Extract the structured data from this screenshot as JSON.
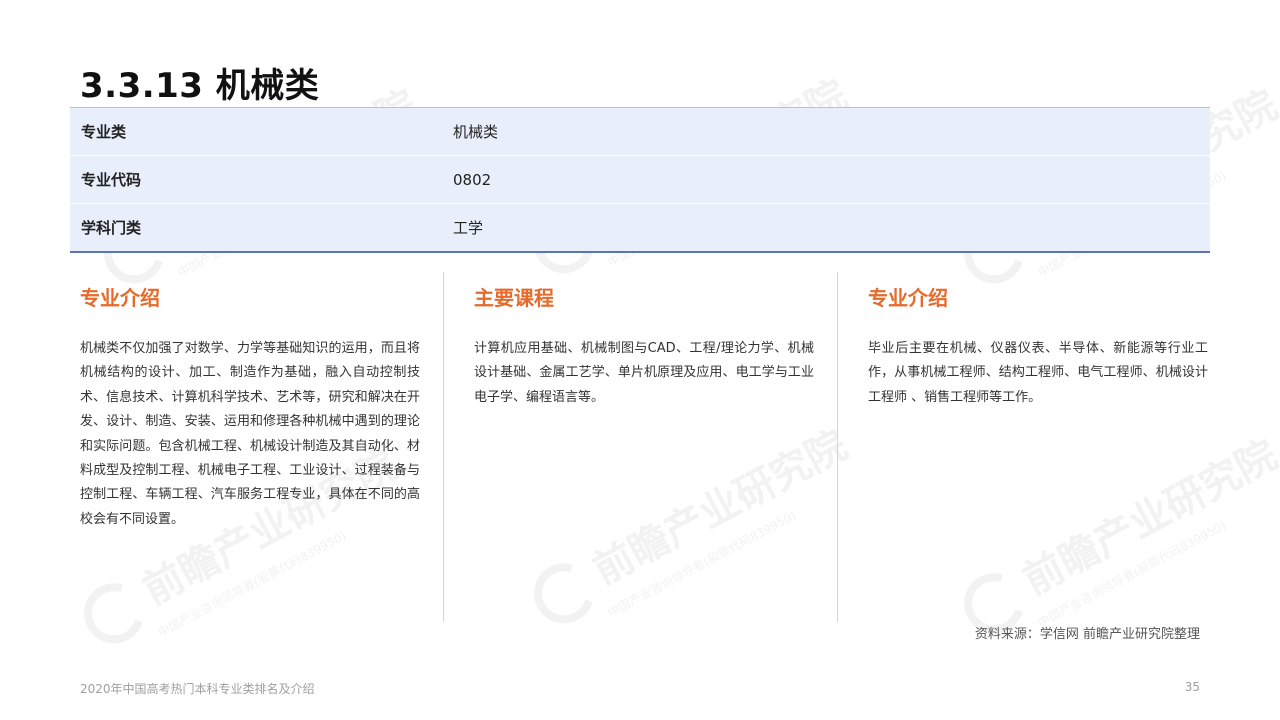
{
  "page": {
    "title": "3.3.13 机械类",
    "footer_left": "2020年中国高考热门本科专业类排名及介绍",
    "page_number": "35",
    "source": "资料来源：学信网 前瞻产业研究院整理"
  },
  "watermark": {
    "brand": "前瞻产业研究院",
    "subtitle": "中国产业咨询领导者(股票代码839950)"
  },
  "info": {
    "rows": [
      {
        "label": "专业类",
        "value": "机械类"
      },
      {
        "label": "专业代码",
        "value": "0802"
      },
      {
        "label": "学科门类",
        "value": "工学"
      }
    ]
  },
  "columns": [
    {
      "heading": "专业介绍",
      "text": "机械类不仅加强了对数学、力学等基础知识的运用，而且将机械结构的设计、加工、制造作为基础，融入自动控制技术、信息技术、计算机科学技术、艺术等，研究和解决在开发、设计、制造、安装、运用和修理各种机械中遇到的理论和实际问题。包含机械工程、机械设计制造及其自动化、材料成型及控制工程、机械电子工程、工业设计、过程装备与控制工程、车辆工程、汽车服务工程专业，具体在不同的高校会有不同设置。"
    },
    {
      "heading": "主要课程",
      "text": "计算机应用基础、机械制图与CAD、工程/理论力学、机械设计基础、金属工艺学、单片机原理及应用、电工学与工业电子学、编程语言等。"
    },
    {
      "heading": "专业介绍",
      "text": "毕业后主要在机械、仪器仪表、半导体、新能源等行业工作，从事机械工程师、结构工程师、电气工程师、机械设计工程师 、销售工程师等工作。"
    }
  ],
  "colors": {
    "accent": "#e86a2b",
    "table_bg": "#e9eefb",
    "table_border": "#5d73b3"
  }
}
